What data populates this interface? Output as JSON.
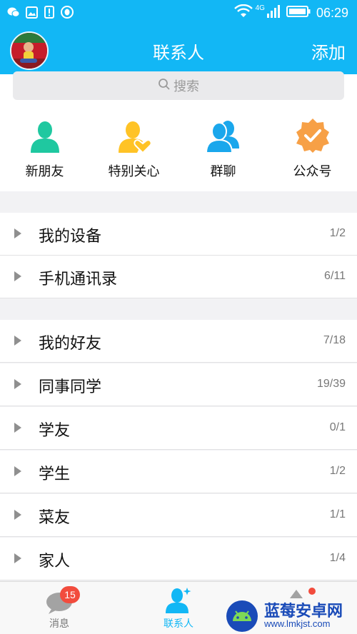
{
  "status_bar": {
    "time": "06:29",
    "network": "4G",
    "icons": [
      "wechat-icon",
      "gallery-icon",
      "sim-alert-icon",
      "qq-icon",
      "wifi-icon",
      "signal-icon",
      "battery-icon"
    ]
  },
  "header": {
    "title": "联系人",
    "add_label": "添加"
  },
  "search": {
    "placeholder": "搜索"
  },
  "quick_actions": [
    {
      "label": "新朋友",
      "icon": "new-friend-icon",
      "color": "#1fc8a0"
    },
    {
      "label": "特别关心",
      "icon": "special-care-icon",
      "color": "#ffc326"
    },
    {
      "label": "群聊",
      "icon": "group-chat-icon",
      "color": "#1aa7ec"
    },
    {
      "label": "公众号",
      "icon": "public-account-icon",
      "color": "#f7a046"
    }
  ],
  "groups_section_1": [
    {
      "label": "我的设备",
      "count": "1/2"
    },
    {
      "label": "手机通讯录",
      "count": "6/11"
    }
  ],
  "groups_section_2": [
    {
      "label": "我的好友",
      "count": "7/18"
    },
    {
      "label": "同事同学",
      "count": "19/39"
    },
    {
      "label": "学友",
      "count": "0/1"
    },
    {
      "label": "学生",
      "count": "1/2"
    },
    {
      "label": "菜友",
      "count": "1/1"
    },
    {
      "label": "家人",
      "count": "1/4"
    }
  ],
  "tabbar": {
    "messages_label": "消息",
    "messages_badge": "15",
    "contacts_label": "联系人",
    "active_color": "#12b7f5"
  },
  "watermark": {
    "text": "蓝莓安卓网",
    "url": "www.lmkjst.com"
  }
}
